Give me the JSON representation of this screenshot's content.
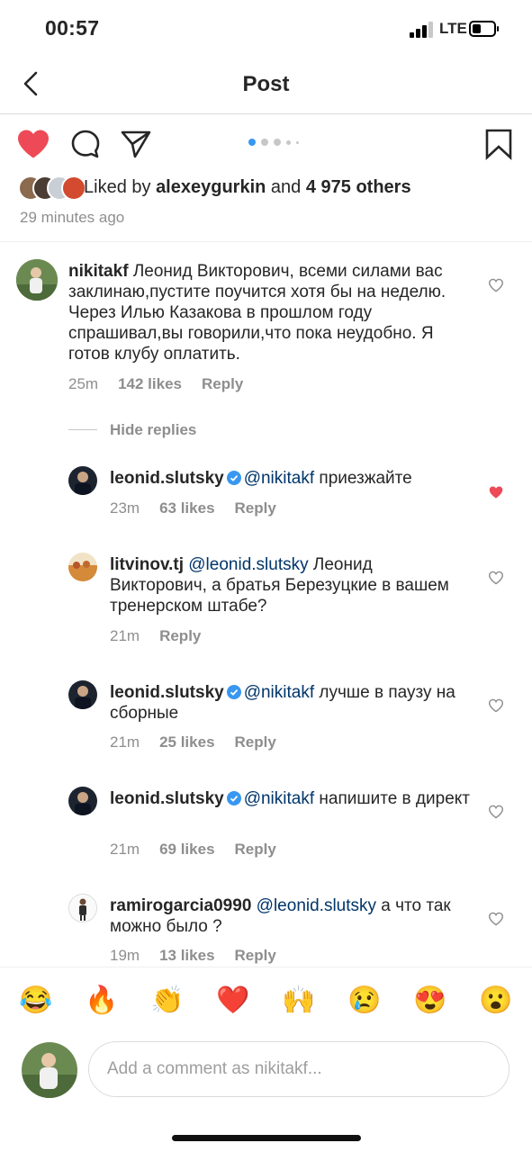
{
  "status_bar": {
    "time": "00:57",
    "network": "LTE"
  },
  "nav": {
    "title": "Post"
  },
  "post": {
    "carousel_dots": 5,
    "liked_by_prefix": "Liked by",
    "liked_by_user": "alexeygurkin",
    "liked_by_and": "and",
    "liked_by_others": "4 975 others",
    "timestamp": "29 minutes ago"
  },
  "comment": {
    "user": "nikitakf",
    "text": "Леонид Викторович, всеми силами вас заклинаю,пустите поучится хотя бы на неделю. Через Илью Казакова в прошлом году спрашивал,вы говорили,что пока неудобно. Я готов клубу оплатить.",
    "time": "25m",
    "likes": "142 likes",
    "reply": "Reply"
  },
  "hide_replies": "Hide replies",
  "replies": [
    {
      "user": "leonid.slutsky",
      "verified": true,
      "mention": "@nikitakf",
      "text": "приезжайте",
      "time": "23m",
      "likes": "63 likes",
      "reply": "Reply",
      "liked": true
    },
    {
      "user": "litvinov.tj",
      "verified": false,
      "mention": "@leonid.slutsky",
      "text": "Леонид Викторович, а братья Березуцкие в вашем тренерском штабе?",
      "time": "21m",
      "likes": "",
      "reply": "Reply",
      "liked": false
    },
    {
      "user": "leonid.slutsky",
      "verified": true,
      "mention": "@nikitakf",
      "text": "лучше в паузу на сборные",
      "time": "21m",
      "likes": "25 likes",
      "reply": "Reply",
      "liked": false
    },
    {
      "user": "leonid.slutsky",
      "verified": true,
      "mention": "@nikitakf",
      "text": "напишите в директ",
      "time": "21m",
      "likes": "69 likes",
      "reply": "Reply",
      "liked": false
    },
    {
      "user": "ramirogarcia0990",
      "verified": false,
      "mention": "@leonid.slutsky",
      "text": "а что так можно было ?",
      "time": "19m",
      "likes": "13 likes",
      "reply": "Reply",
      "liked": false
    }
  ],
  "emoji_bar": [
    "😂",
    "🔥",
    "👏",
    "❤️",
    "🙌",
    "😢",
    "😍",
    "😮"
  ],
  "composer": {
    "placeholder": "Add a comment as nikitakf..."
  },
  "colors": {
    "accent_blue": "#3897f0",
    "like_red": "#ed4956",
    "mention": "#003569",
    "secondary_text": "#8e8e8e"
  }
}
